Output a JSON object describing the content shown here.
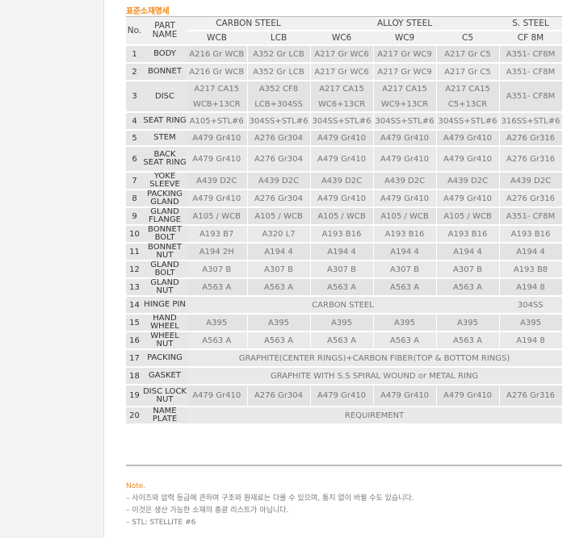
{
  "title": "표준소재명세",
  "header": {
    "no": "No.",
    "part_name": "PART NAME",
    "groups": [
      "CARBON STEEL",
      "ALLOY STEEL",
      "S. STEEL"
    ],
    "subs": [
      "WCB",
      "LCB",
      "WC6",
      "WC9",
      "C5",
      "CF 8M"
    ]
  },
  "rows": [
    {
      "no": "1",
      "part": "BODY",
      "v": [
        "A216 Gr WCB",
        "A352 Gr LCB",
        "A217 Gr WC6",
        "A217 Gr WC9",
        "A217 Gr C5",
        "A351- CF8M"
      ]
    },
    {
      "no": "2",
      "part": "BONNET",
      "v": [
        "A216 Gr WCB",
        "A352 Gr LCB",
        "A217 Gr WC6",
        "A217 Gr WC9",
        "A217 Gr C5",
        "A351- CF8M"
      ]
    },
    {
      "no": "3",
      "part": "DISC",
      "v": [
        "A217 CA15",
        "A352 CF8",
        "A217 CA15",
        "A217 CA15",
        "A217 CA15",
        "A351- CF8M"
      ],
      "v2": [
        "WCB+13CR",
        "LCB+304SS",
        "WC6+13CR",
        "WC9+13CR",
        "C5+13CR"
      ]
    },
    {
      "no": "4",
      "part": "SEAT RING",
      "v": [
        "A105+STL#6",
        "304SS+STL#6",
        "304SS+STL#6",
        "304SS+STL#6",
        "304SS+STL#6",
        "316SS+STL#6"
      ]
    },
    {
      "no": "5",
      "part": "STEM",
      "v": [
        "A479 Gr410",
        "A276 Gr304",
        "A479 Gr410",
        "A479 Gr410",
        "A479 Gr410",
        "A276 Gr316"
      ]
    },
    {
      "no": "6",
      "part": "BACK SEAT RING",
      "v": [
        "A479 Gr410",
        "A276 Gr304",
        "A479 Gr410",
        "A479 Gr410",
        "A479 Gr410",
        "A276 Gr316"
      ]
    },
    {
      "no": "7",
      "part": "YOKE SLEEVE",
      "v": [
        "A439 D2C",
        "A439 D2C",
        "A439 D2C",
        "A439 D2C",
        "A439 D2C",
        "A439 D2C"
      ]
    },
    {
      "no": "8",
      "part": "PACKING GLAND",
      "v": [
        "A479 Gr410",
        "A276 Gr304",
        "A479 Gr410",
        "A479 Gr410",
        "A479 Gr410",
        "A276 Gr316"
      ]
    },
    {
      "no": "9",
      "part": "GLAND FLANGE",
      "v": [
        "A105 / WCB",
        "A105 / WCB",
        "A105 / WCB",
        "A105 / WCB",
        "A105 / WCB",
        "A351- CF8M"
      ]
    },
    {
      "no": "10",
      "part": "BONNET BOLT",
      "v": [
        "A193 B7",
        "A320 L7",
        "A193 B16",
        "A193 B16",
        "A193 B16",
        "A193 B16"
      ]
    },
    {
      "no": "11",
      "part": "BONNET NUT",
      "v": [
        "A194 2H",
        "A194 4",
        "A194 4",
        "A194 4",
        "A194 4",
        "A194 4"
      ]
    },
    {
      "no": "12",
      "part": "GLAND BOLT",
      "v": [
        "A307 B",
        "A307 B",
        "A307 B",
        "A307 B",
        "A307 B",
        "A193 B8"
      ]
    },
    {
      "no": "13",
      "part": "GLAND NUT",
      "v": [
        "A563 A",
        "A563 A",
        "A563 A",
        "A563 A",
        "A563 A",
        "A194 8"
      ]
    },
    {
      "no": "14",
      "part": "HINGE PIN",
      "span": "CARBON STEEL",
      "last": "304SS"
    },
    {
      "no": "15",
      "part": "HAND WHEEL",
      "v": [
        "A395",
        "A395",
        "A395",
        "A395",
        "A395",
        "A395"
      ]
    },
    {
      "no": "16",
      "part": "WHEEL NUT",
      "v": [
        "A563 A",
        "A563 A",
        "A563 A",
        "A563 A",
        "A563 A",
        "A194 8"
      ]
    },
    {
      "no": "17",
      "part": "PACKING",
      "full": "GRAPHITE(CENTER RINGS)+CARBON FIBER(TOP & BOTTOM RINGS)"
    },
    {
      "no": "18",
      "part": "GASKET",
      "full": "GRAPHITE WITH S.S SPIRAL WOUND or METAL RING"
    },
    {
      "no": "19",
      "part": "DISC LOCK NUT",
      "v": [
        "A479 Gr410",
        "A276 Gr304",
        "A479 Gr410",
        "A479 Gr410",
        "A479 Gr410",
        "A276 Gr316"
      ]
    },
    {
      "no": "20",
      "part": "NAME PLATE",
      "full": "REQUIREMENT"
    }
  ],
  "notes": {
    "heading": "Note.",
    "lines": [
      "– 사이즈와 압력 등급에 관하여 구조와 원재료는 다를 수 있으며, 통지 없이 바뀔 수도 있습니다.",
      "– 이것은 생산 가능한 소재의 총괄 리스트가 아닙니다.",
      "– STL: STELLITE #6"
    ]
  }
}
